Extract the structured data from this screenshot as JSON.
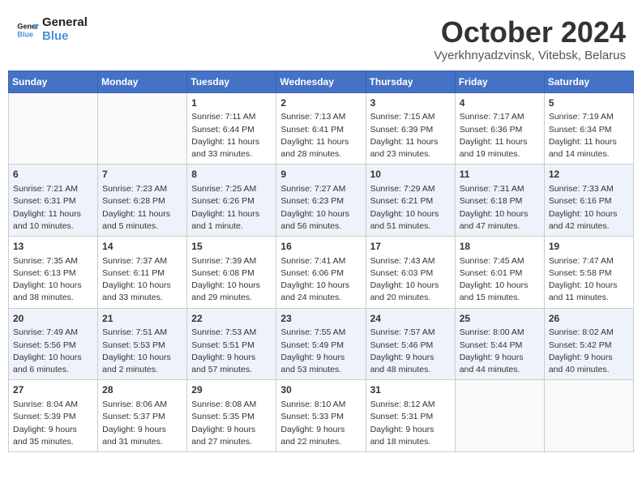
{
  "header": {
    "logo_line1": "General",
    "logo_line2": "Blue",
    "month": "October 2024",
    "location": "Vyerkhnyadzvinsk, Vitebsk, Belarus"
  },
  "days_of_week": [
    "Sunday",
    "Monday",
    "Tuesday",
    "Wednesday",
    "Thursday",
    "Friday",
    "Saturday"
  ],
  "weeks": [
    [
      {
        "day": "",
        "info": ""
      },
      {
        "day": "",
        "info": ""
      },
      {
        "day": "1",
        "info": "Sunrise: 7:11 AM\nSunset: 6:44 PM\nDaylight: 11 hours and 33 minutes."
      },
      {
        "day": "2",
        "info": "Sunrise: 7:13 AM\nSunset: 6:41 PM\nDaylight: 11 hours and 28 minutes."
      },
      {
        "day": "3",
        "info": "Sunrise: 7:15 AM\nSunset: 6:39 PM\nDaylight: 11 hours and 23 minutes."
      },
      {
        "day": "4",
        "info": "Sunrise: 7:17 AM\nSunset: 6:36 PM\nDaylight: 11 hours and 19 minutes."
      },
      {
        "day": "5",
        "info": "Sunrise: 7:19 AM\nSunset: 6:34 PM\nDaylight: 11 hours and 14 minutes."
      }
    ],
    [
      {
        "day": "6",
        "info": "Sunrise: 7:21 AM\nSunset: 6:31 PM\nDaylight: 11 hours and 10 minutes."
      },
      {
        "day": "7",
        "info": "Sunrise: 7:23 AM\nSunset: 6:28 PM\nDaylight: 11 hours and 5 minutes."
      },
      {
        "day": "8",
        "info": "Sunrise: 7:25 AM\nSunset: 6:26 PM\nDaylight: 11 hours and 1 minute."
      },
      {
        "day": "9",
        "info": "Sunrise: 7:27 AM\nSunset: 6:23 PM\nDaylight: 10 hours and 56 minutes."
      },
      {
        "day": "10",
        "info": "Sunrise: 7:29 AM\nSunset: 6:21 PM\nDaylight: 10 hours and 51 minutes."
      },
      {
        "day": "11",
        "info": "Sunrise: 7:31 AM\nSunset: 6:18 PM\nDaylight: 10 hours and 47 minutes."
      },
      {
        "day": "12",
        "info": "Sunrise: 7:33 AM\nSunset: 6:16 PM\nDaylight: 10 hours and 42 minutes."
      }
    ],
    [
      {
        "day": "13",
        "info": "Sunrise: 7:35 AM\nSunset: 6:13 PM\nDaylight: 10 hours and 38 minutes."
      },
      {
        "day": "14",
        "info": "Sunrise: 7:37 AM\nSunset: 6:11 PM\nDaylight: 10 hours and 33 minutes."
      },
      {
        "day": "15",
        "info": "Sunrise: 7:39 AM\nSunset: 6:08 PM\nDaylight: 10 hours and 29 minutes."
      },
      {
        "day": "16",
        "info": "Sunrise: 7:41 AM\nSunset: 6:06 PM\nDaylight: 10 hours and 24 minutes."
      },
      {
        "day": "17",
        "info": "Sunrise: 7:43 AM\nSunset: 6:03 PM\nDaylight: 10 hours and 20 minutes."
      },
      {
        "day": "18",
        "info": "Sunrise: 7:45 AM\nSunset: 6:01 PM\nDaylight: 10 hours and 15 minutes."
      },
      {
        "day": "19",
        "info": "Sunrise: 7:47 AM\nSunset: 5:58 PM\nDaylight: 10 hours and 11 minutes."
      }
    ],
    [
      {
        "day": "20",
        "info": "Sunrise: 7:49 AM\nSunset: 5:56 PM\nDaylight: 10 hours and 6 minutes."
      },
      {
        "day": "21",
        "info": "Sunrise: 7:51 AM\nSunset: 5:53 PM\nDaylight: 10 hours and 2 minutes."
      },
      {
        "day": "22",
        "info": "Sunrise: 7:53 AM\nSunset: 5:51 PM\nDaylight: 9 hours and 57 minutes."
      },
      {
        "day": "23",
        "info": "Sunrise: 7:55 AM\nSunset: 5:49 PM\nDaylight: 9 hours and 53 minutes."
      },
      {
        "day": "24",
        "info": "Sunrise: 7:57 AM\nSunset: 5:46 PM\nDaylight: 9 hours and 48 minutes."
      },
      {
        "day": "25",
        "info": "Sunrise: 8:00 AM\nSunset: 5:44 PM\nDaylight: 9 hours and 44 minutes."
      },
      {
        "day": "26",
        "info": "Sunrise: 8:02 AM\nSunset: 5:42 PM\nDaylight: 9 hours and 40 minutes."
      }
    ],
    [
      {
        "day": "27",
        "info": "Sunrise: 8:04 AM\nSunset: 5:39 PM\nDaylight: 9 hours and 35 minutes."
      },
      {
        "day": "28",
        "info": "Sunrise: 8:06 AM\nSunset: 5:37 PM\nDaylight: 9 hours and 31 minutes."
      },
      {
        "day": "29",
        "info": "Sunrise: 8:08 AM\nSunset: 5:35 PM\nDaylight: 9 hours and 27 minutes."
      },
      {
        "day": "30",
        "info": "Sunrise: 8:10 AM\nSunset: 5:33 PM\nDaylight: 9 hours and 22 minutes."
      },
      {
        "day": "31",
        "info": "Sunrise: 8:12 AM\nSunset: 5:31 PM\nDaylight: 9 hours and 18 minutes."
      },
      {
        "day": "",
        "info": ""
      },
      {
        "day": "",
        "info": ""
      }
    ]
  ]
}
